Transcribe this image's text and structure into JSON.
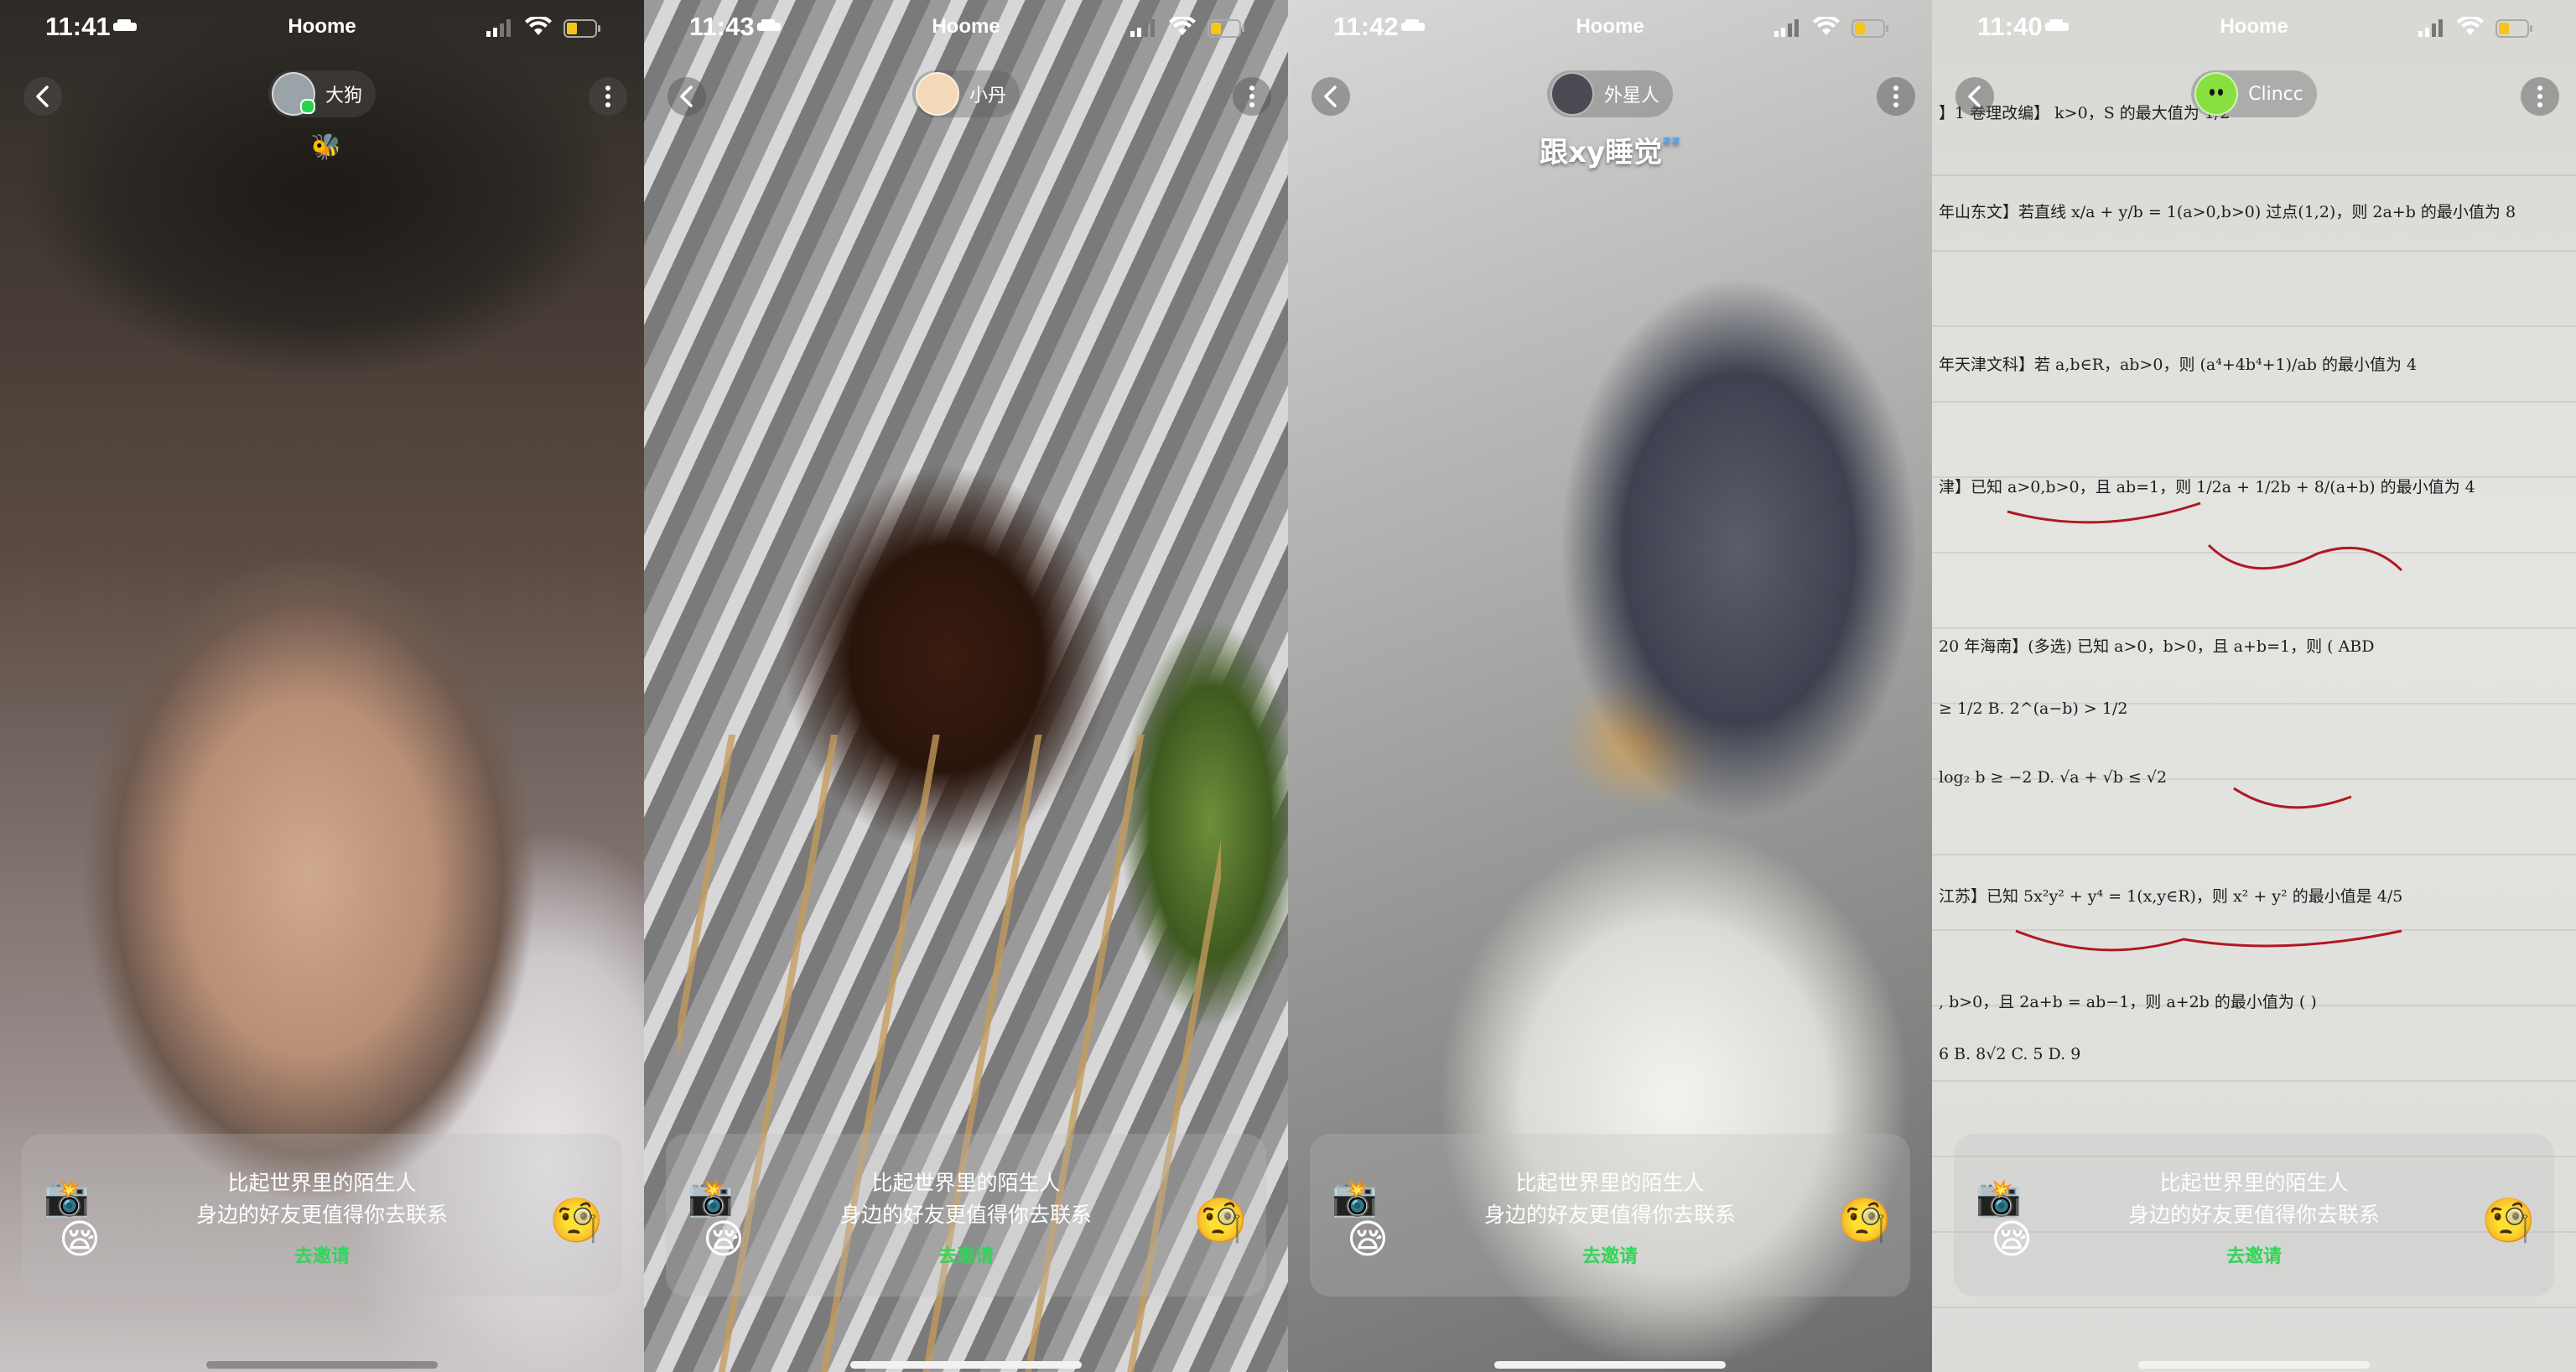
{
  "status": {
    "app_name": "Hoome"
  },
  "invite": {
    "line1": "比起世界里的陌生人",
    "line2": "身边的好友更值得你去联系",
    "link": "去邀请"
  },
  "screens": [
    {
      "time": "11:41",
      "user": "大狗",
      "caption": "",
      "online": true,
      "avatar_color": "#9aa3a8"
    },
    {
      "time": "11:43",
      "user": "小丹",
      "caption": "",
      "online": false,
      "avatar_color": "#f3d9b7"
    },
    {
      "time": "11:42",
      "user": "外星人",
      "caption": "跟xy睡觉",
      "caption_emoji": "ᶻᶻ",
      "online": false,
      "avatar_color": "#4a4b52"
    },
    {
      "time": "11:40",
      "user": "Clincc",
      "caption": "",
      "online": false,
      "avatar_color": "#88e040"
    }
  ],
  "paper": {
    "lines": [
      "】1 卷理改编】 k>0，S 的最大值为 1/2",
      "年山东文】若直线 x/a + y/b = 1(a>0,b>0) 过点(1,2)，则 2a+b 的最小值为 8",
      "年天津文科】若 a,b∈R，ab>0，则 (a⁴+4b⁴+1)/ab 的最小值为 4",
      "津】已知 a>0,b>0，且 ab=1，则 1/2a + 1/2b + 8/(a+b) 的最小值为 4",
      "20 年海南】(多选) 已知 a>0，b>0，且 a+b=1，则 ( ABD",
      "≥ 1/2          B. 2^(a−b) > 1/2",
      "log₂ b ≥ −2     D. √a + √b ≤ √2",
      "江苏】已知 5x²y² + y⁴ = 1(x,y∈R)，则 x² + y² 的最小值是 4/5",
      ", b>0，且 2a+b = ab−1，则 a+2b 的最小值为 ( )",
      "6     B. 8√2     C. 5     D. 9"
    ]
  },
  "colors": {
    "invite_link": "#33d45a",
    "online_dot": "#27d34a",
    "caption_zz": "#4aa3ff",
    "battery_fill": "#f5c518"
  }
}
